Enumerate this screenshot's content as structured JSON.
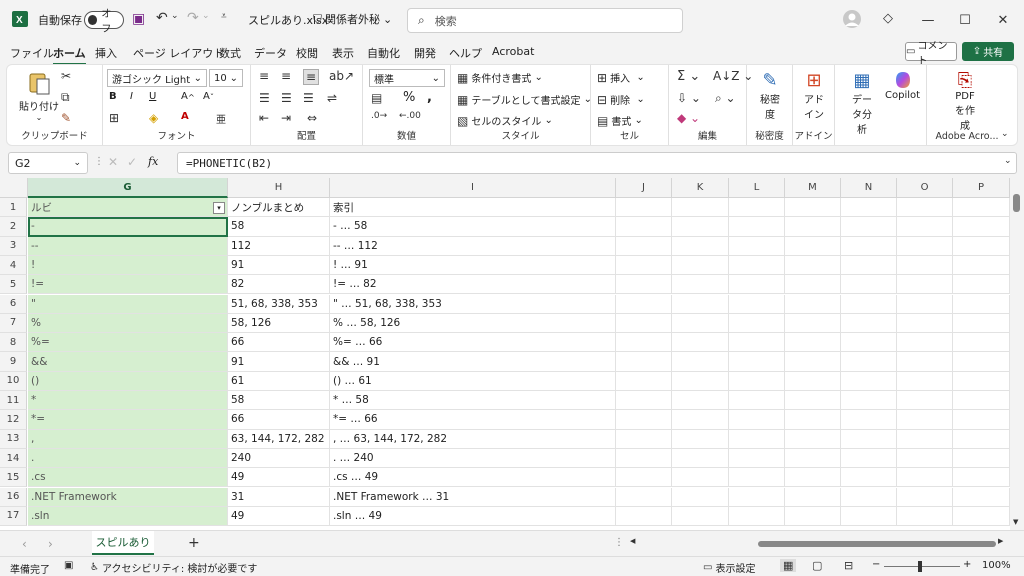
{
  "title_bar": {
    "autosave_label": "自動保存",
    "autosave_state": "オフ",
    "filename": "スピルあり.xlsx",
    "sensitivity": "関係者外秘",
    "search_placeholder": "検索"
  },
  "menu": {
    "items": [
      "ファイル",
      "ホーム",
      "挿入",
      "ページ レイアウト",
      "数式",
      "データ",
      "校閲",
      "表示",
      "自動化",
      "開発",
      "ヘルプ",
      "Acrobat"
    ],
    "active": "ホーム",
    "comment_label": "コメント",
    "share_label": "共有"
  },
  "ribbon": {
    "clipboard": {
      "paste": "貼り付け",
      "label": "クリップボード"
    },
    "font": {
      "name": "游ゴシック Light",
      "size": "10",
      "label": "フォント"
    },
    "alignment": {
      "label": "配置"
    },
    "number": {
      "format": "標準",
      "label": "数値"
    },
    "style": {
      "conditional": "条件付き書式",
      "table": "テーブルとして書式設定",
      "cell_style": "セルのスタイル",
      "label": "スタイル"
    },
    "cells": {
      "insert": "挿入",
      "delete": "削除",
      "format": "書式",
      "label": "セル"
    },
    "editing": {
      "label": "編集"
    },
    "sensitivity": {
      "btn": "秘密度",
      "label": "秘密度"
    },
    "addins": {
      "btn": "アドイン",
      "label": "アドイン"
    },
    "analysis": {
      "btn": "データ分析"
    },
    "copilot": {
      "btn": "Copilot"
    },
    "pdf": {
      "btn": "PDFを作成",
      "label": "Adobe Acro..."
    }
  },
  "formula_bar": {
    "cell_ref": "G2",
    "formula": "=PHONETIC(B2)"
  },
  "columns": [
    "G",
    "H",
    "I",
    "J",
    "K",
    "L",
    "M",
    "N",
    "O",
    "P"
  ],
  "rows": [
    {
      "n": "1",
      "g": "ルビ",
      "h": "ノンブルまとめ",
      "i": "索引"
    },
    {
      "n": "2",
      "g": "-",
      "h": "58",
      "i": "- … 58"
    },
    {
      "n": "3",
      "g": "--",
      "h": "112",
      "i": "-- … 112"
    },
    {
      "n": "4",
      "g": "!",
      "h": "91",
      "i": "! … 91"
    },
    {
      "n": "5",
      "g": "!=",
      "h": "82",
      "i": "!= … 82"
    },
    {
      "n": "6",
      "g": "\"",
      "h": "51, 68, 338, 353",
      "i": "\" … 51, 68, 338, 353"
    },
    {
      "n": "7",
      "g": "%",
      "h": "58, 126",
      "i": "% … 58, 126"
    },
    {
      "n": "8",
      "g": "%=",
      "h": "66",
      "i": "%= … 66"
    },
    {
      "n": "9",
      "g": "&&",
      "h": "91",
      "i": "&& … 91"
    },
    {
      "n": "10",
      "g": "()",
      "h": "61",
      "i": "() … 61"
    },
    {
      "n": "11",
      "g": "*",
      "h": "58",
      "i": "* … 58"
    },
    {
      "n": "12",
      "g": "*=",
      "h": "66",
      "i": "*= … 66"
    },
    {
      "n": "13",
      "g": ",",
      "h": "63, 144, 172, 282",
      "i": ", … 63, 144, 172, 282"
    },
    {
      "n": "14",
      "g": ".",
      "h": "240",
      "i": ". … 240"
    },
    {
      "n": "15",
      "g": ".cs",
      "h": "49",
      "i": ".cs … 49"
    },
    {
      "n": "16",
      "g": ".NET Framework",
      "h": "31",
      "i": ".NET Framework … 31"
    },
    {
      "n": "17",
      "g": ".sln",
      "h": "49",
      "i": ".sln … 49"
    }
  ],
  "sheet_tabs": [
    "スピルあり"
  ],
  "status": {
    "ready": "準備完了",
    "accessibility": "アクセシビリティ: 検討が必要です",
    "display_settings": "表示設定",
    "zoom": "100%"
  }
}
